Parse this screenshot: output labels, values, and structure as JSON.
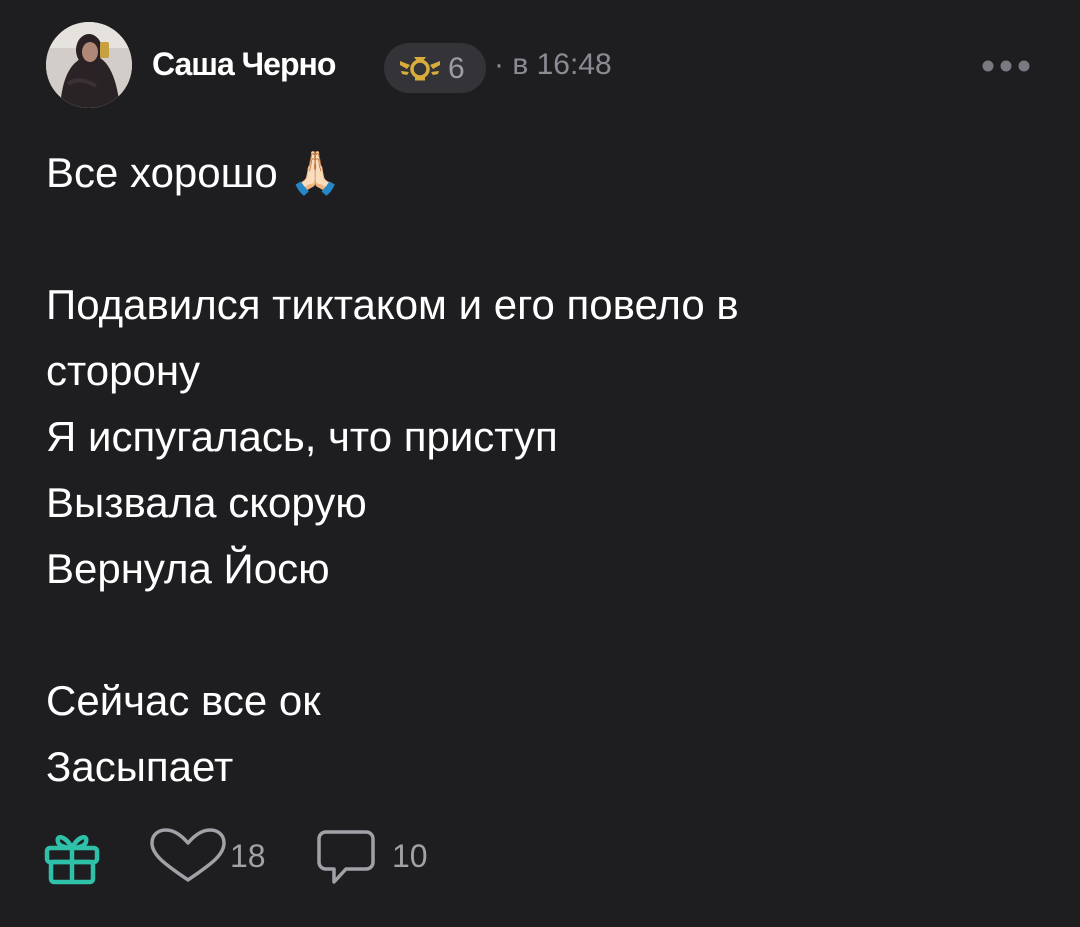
{
  "post": {
    "author": "Саша Черно",
    "level": "6",
    "time": "· в 16:48",
    "lines": [
      "Все хорошо 🙏🏻",
      "",
      "Подавился тиктаком и его повело в",
      "сторону",
      "Я испугалась, что приступ",
      "Вызвала скорую",
      "Вернула Йосю",
      "",
      "Сейчас все ок",
      "Засыпает"
    ]
  },
  "actions": {
    "likes": "18",
    "comments": "10"
  },
  "icons": {
    "avatar": "user-avatar",
    "level": "level-badge-icon",
    "more": "more-dots-icon",
    "gift": "gift-icon",
    "like": "heart-icon",
    "comment": "comment-icon"
  },
  "colors": {
    "background": "#1e1d20",
    "text": "#ffffff",
    "muted": "#8c8a92",
    "badge_bg": "#343338",
    "badge_gold": "#d9ad3c",
    "gift_teal": "#2ec0a8"
  }
}
